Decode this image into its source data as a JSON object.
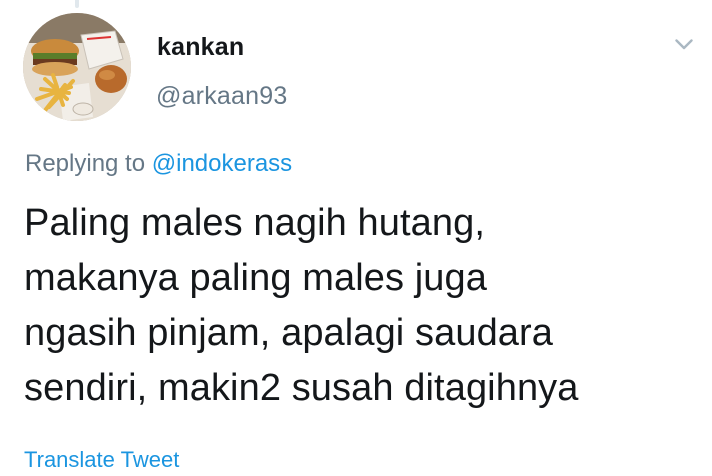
{
  "tweet": {
    "user": {
      "name": "kankan",
      "handle": "@arkaan93"
    },
    "reply": {
      "prefix": "Replying to",
      "mention": "@indokerass"
    },
    "text_lines": [
      "Paling males nagih hutang,",
      "makanya paling males juga",
      "ngasih pinjam, apalagi saudara",
      "sendiri, makin2 susah ditagihnya"
    ],
    "translate_label": "Translate Tweet",
    "icons": {
      "menu": "chevron-down-icon",
      "avatar": "food-photo-avatar"
    },
    "colors": {
      "text_primary": "#14171a",
      "text_secondary": "#657786",
      "link": "#1b95e0"
    }
  }
}
